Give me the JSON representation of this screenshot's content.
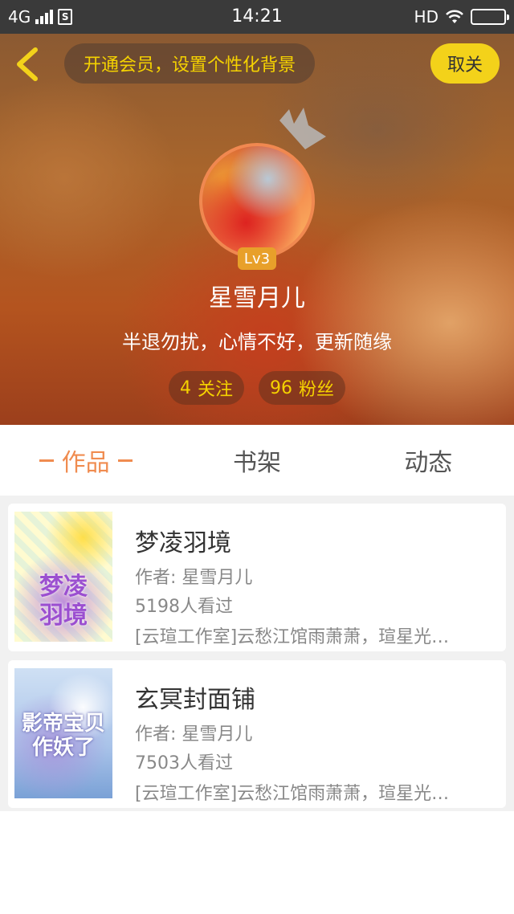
{
  "status_bar": {
    "network": "4G",
    "sim_label": "S",
    "time": "14:21",
    "hd": "HD"
  },
  "header": {
    "vip_prompt": "开通会员，设置个性化背景",
    "follow_button": "取关",
    "level": "Lv3",
    "username": "星雪月儿",
    "bio": "半退勿扰，心情不好，更新随缘",
    "following_count": "4",
    "following_label": "关注",
    "fans_count": "96",
    "fans_label": "粉丝"
  },
  "tabs": [
    {
      "label": "作品",
      "active": true
    },
    {
      "label": "书架",
      "active": false
    },
    {
      "label": "动态",
      "active": false
    }
  ],
  "books": [
    {
      "title": "梦凌羽境",
      "author": "作者: 星雪月儿",
      "views": "5198人看过",
      "description": "[云瑄工作室]云愁江馆雨萧萧，瑄星光…",
      "cover_text": "梦凌\n羽境"
    },
    {
      "title": "玄冥封面铺",
      "author": "作者: 星雪月儿",
      "views": "7503人看过",
      "description": "[云瑄工作室]云愁江馆雨萧萧，瑄星光…",
      "cover_text": "影帝宝贝\n作妖了"
    }
  ],
  "colors": {
    "accent": "#f08c50",
    "follow_bg": "#f3d21a",
    "vip_text": "#f5d200",
    "level_bg": "#e8a02a"
  }
}
